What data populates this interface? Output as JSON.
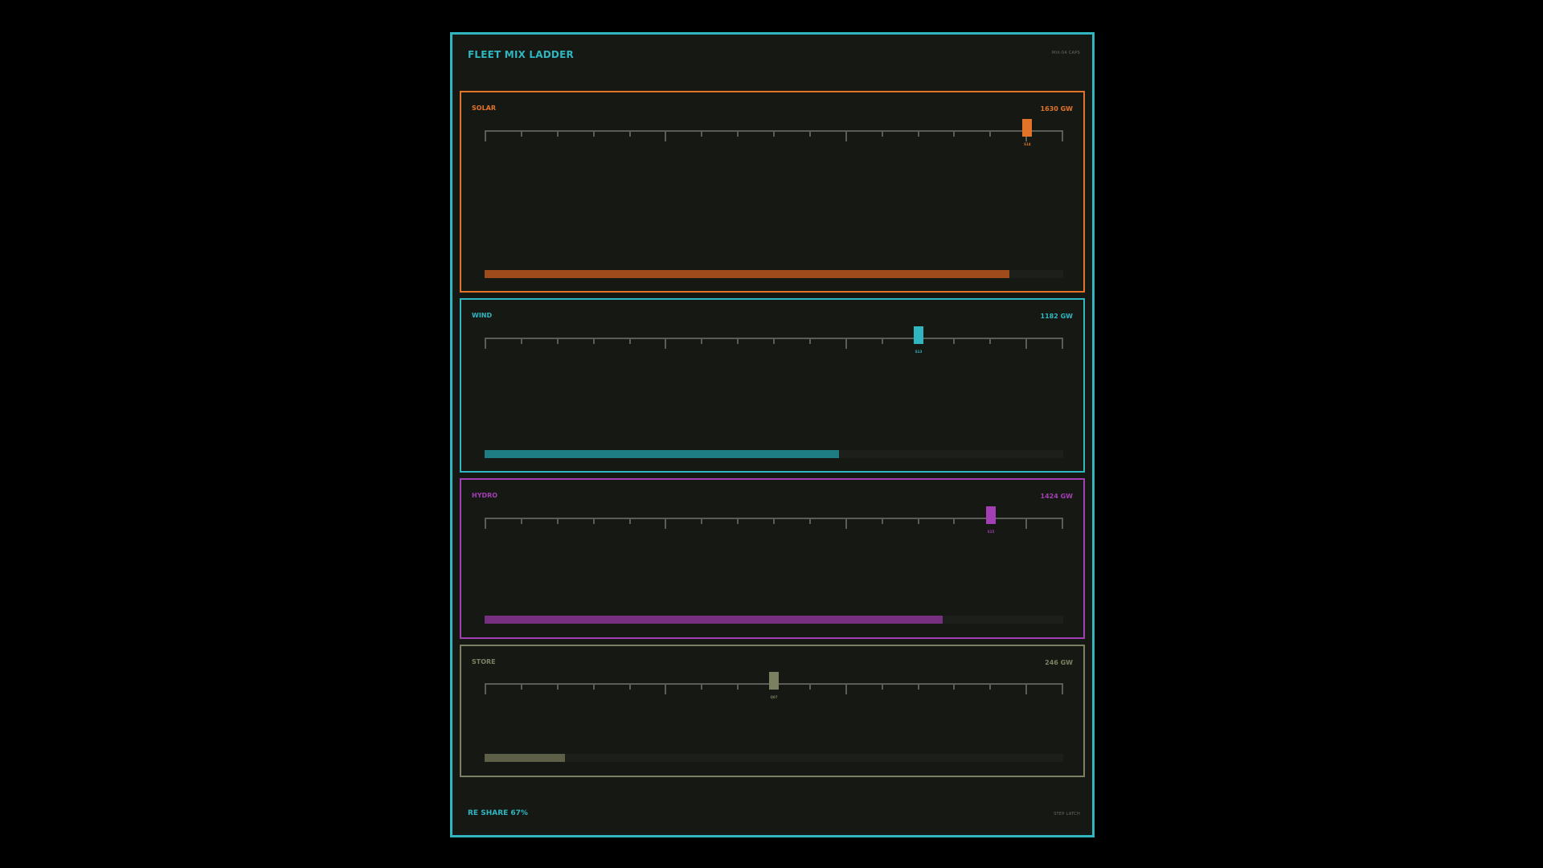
{
  "header": {
    "title": "FLEET MIX LADDER",
    "meta": "MIX-04 CAPS"
  },
  "footer": {
    "share": "RE SHARE 67%",
    "mode": "STEP LATCH"
  },
  "colors": {
    "accent": "#2fb6c0",
    "solar": "#e2742a",
    "wind": "#2fb6c0",
    "hydro": "#a23fb4",
    "store": "#7c8062"
  },
  "rows": [
    {
      "label": "SOLAR",
      "value": "1630 GW",
      "thumb_code": "S14",
      "color": "#e2742a",
      "bar_color": "#a04b1c",
      "thumb_position": 0.938,
      "share": 0.907
    },
    {
      "label": "WIND",
      "value": "1182 GW",
      "thumb_code": "S13",
      "color": "#2fb6c0",
      "bar_color": "#1e7d82",
      "thumb_position": 0.75,
      "share": 0.613
    },
    {
      "label": "HYDRO",
      "value": "1424 GW",
      "thumb_code": "S15",
      "color": "#a23fb4",
      "bar_color": "#76307f",
      "thumb_position": 0.875,
      "share": 0.792
    },
    {
      "label": "STORE",
      "value": "246 GW",
      "thumb_code": "Q07",
      "color": "#7c8062",
      "bar_color": "#5d6046",
      "thumb_position": 0.5,
      "share": 0.139
    }
  ]
}
